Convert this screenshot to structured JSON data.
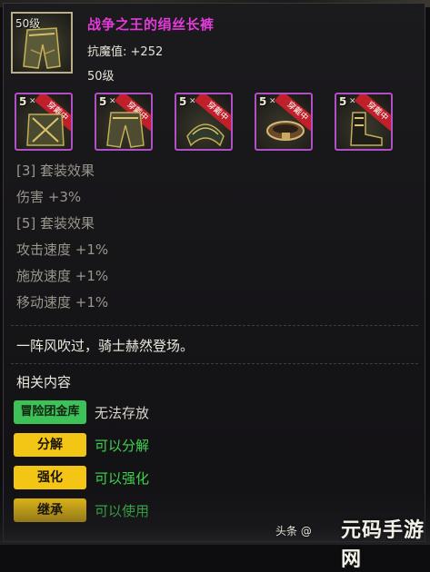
{
  "item": {
    "level_badge": "50级",
    "name": "战争之王的绢丝长裤",
    "stat_label": "抗魔值:",
    "stat_value": "+252",
    "required_level": "50级"
  },
  "set_slots": [
    {
      "level": "5",
      "ribbon": "穿戴中",
      "name": "chest-armor"
    },
    {
      "level": "5",
      "ribbon": "穿戴中",
      "name": "pants-armor"
    },
    {
      "level": "5",
      "ribbon": "穿戴中",
      "name": "shoulder-armor"
    },
    {
      "level": "5",
      "ribbon": "穿戴中",
      "name": "belt-armor"
    },
    {
      "level": "5",
      "ribbon": "穿戴中",
      "name": "boots-armor"
    }
  ],
  "set_effects": [
    "[3] 套装效果",
    "伤害 +3%",
    "[5] 套装效果",
    "攻击速度 +1%",
    "施放速度 +1%",
    "移动速度 +1%"
  ],
  "flavor_text": "一阵风吹过，骑士赫然登场。",
  "related": {
    "title": "相关内容",
    "rows": [
      {
        "tag": "冒险团金库",
        "tag_color": "#3dc25a",
        "text": "无法存放",
        "text_color": "#d8d5cc"
      },
      {
        "tag": "分解",
        "tag_color": "#f3c615",
        "text": "可以分解",
        "text_color": "#3fd34f"
      },
      {
        "tag": "强化",
        "tag_color": "#f3c615",
        "text": "可以强化",
        "text_color": "#3fd34f"
      },
      {
        "tag": "继承",
        "tag_color": "#f3c615",
        "text": "可以使用",
        "text_color": "#3fd34f"
      }
    ]
  },
  "watermark": {
    "source": "头条 @",
    "brand": "元码手游网"
  }
}
